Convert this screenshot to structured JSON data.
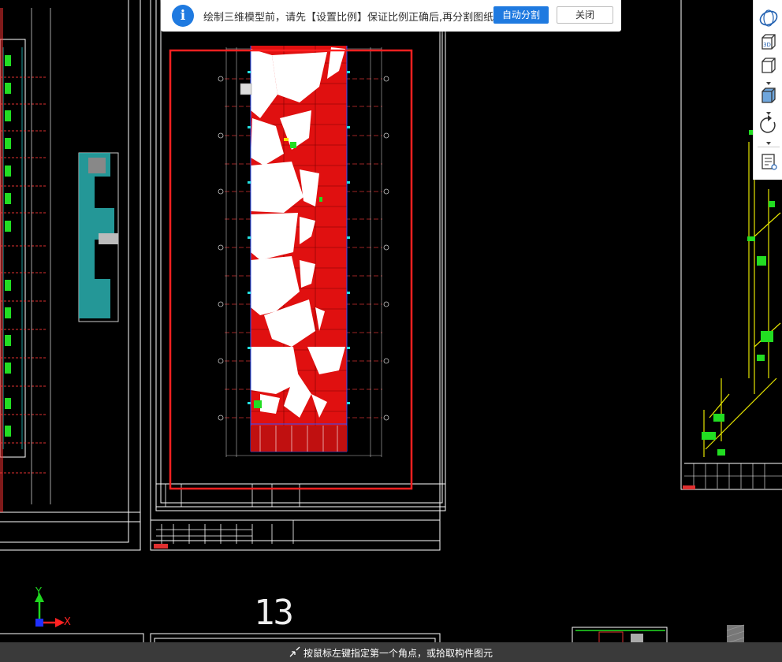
{
  "notification": {
    "message": "绘制三维模型前，请先【设置比例】保证比例正确后,再分割图纸。",
    "primary_button": "自动分割",
    "close_button": "关闭",
    "icon": "info-icon"
  },
  "toolbar": {
    "items": [
      {
        "name": "orbit-icon"
      },
      {
        "name": "3d-view-icon",
        "label": "3D"
      },
      {
        "name": "cube-view-icon"
      },
      {
        "name": "solid-cube-icon"
      },
      {
        "name": "rotate-icon"
      },
      {
        "name": "layer-list-icon"
      }
    ]
  },
  "canvas": {
    "page_number": "13",
    "axis_y_label": "Y",
    "axis_x_label": "X",
    "colors": {
      "background": "#000000",
      "selection": "#ff2020",
      "frame": "#ffffff",
      "axis_x": "#ff2222",
      "axis_y": "#1fd61f"
    }
  },
  "status": {
    "prompt": "按鼠标左键指定第一个角点，或拾取构件图元"
  }
}
